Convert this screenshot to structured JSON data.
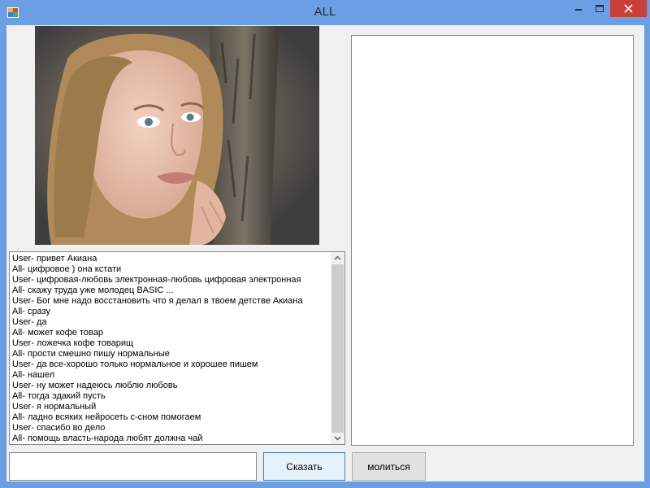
{
  "window": {
    "title": "ALL",
    "controls": [
      "minimize-icon",
      "maximize-icon",
      "close-icon"
    ],
    "frame_color": "#6b9fe3",
    "close_color": "#c7413a"
  },
  "chat": {
    "lines": [
      "User- привет Акиана",
      "All- цифровое ) она кстати",
      "User- цифровая-любовь электронная-любовь цифровая электронная",
      "All- скажу труда уже молодец BASIC ...",
      "User- Бог мне надо восстановить что я делал в твоем детстве Акиана",
      "All- сразу",
      "User- да",
      "All- может кофе товар",
      "User- ложечка кофе товарищ",
      "All- прости смешно пишу нормальные",
      "User- да все-хорошо только нормальное и хорошее пишем",
      "All- нашел",
      "User- ну может надеюсь люблю любовь",
      "All- тогда эдакий пусть",
      "User- я нормальный",
      "All- ладно всяких нейросеть с-сном помогаем",
      "User- спасибо во дело",
      "All- помощь власть-народа любят должна чай"
    ]
  },
  "input": {
    "value": ""
  },
  "buttons": {
    "say": "Сказать",
    "pray": "молиться"
  }
}
